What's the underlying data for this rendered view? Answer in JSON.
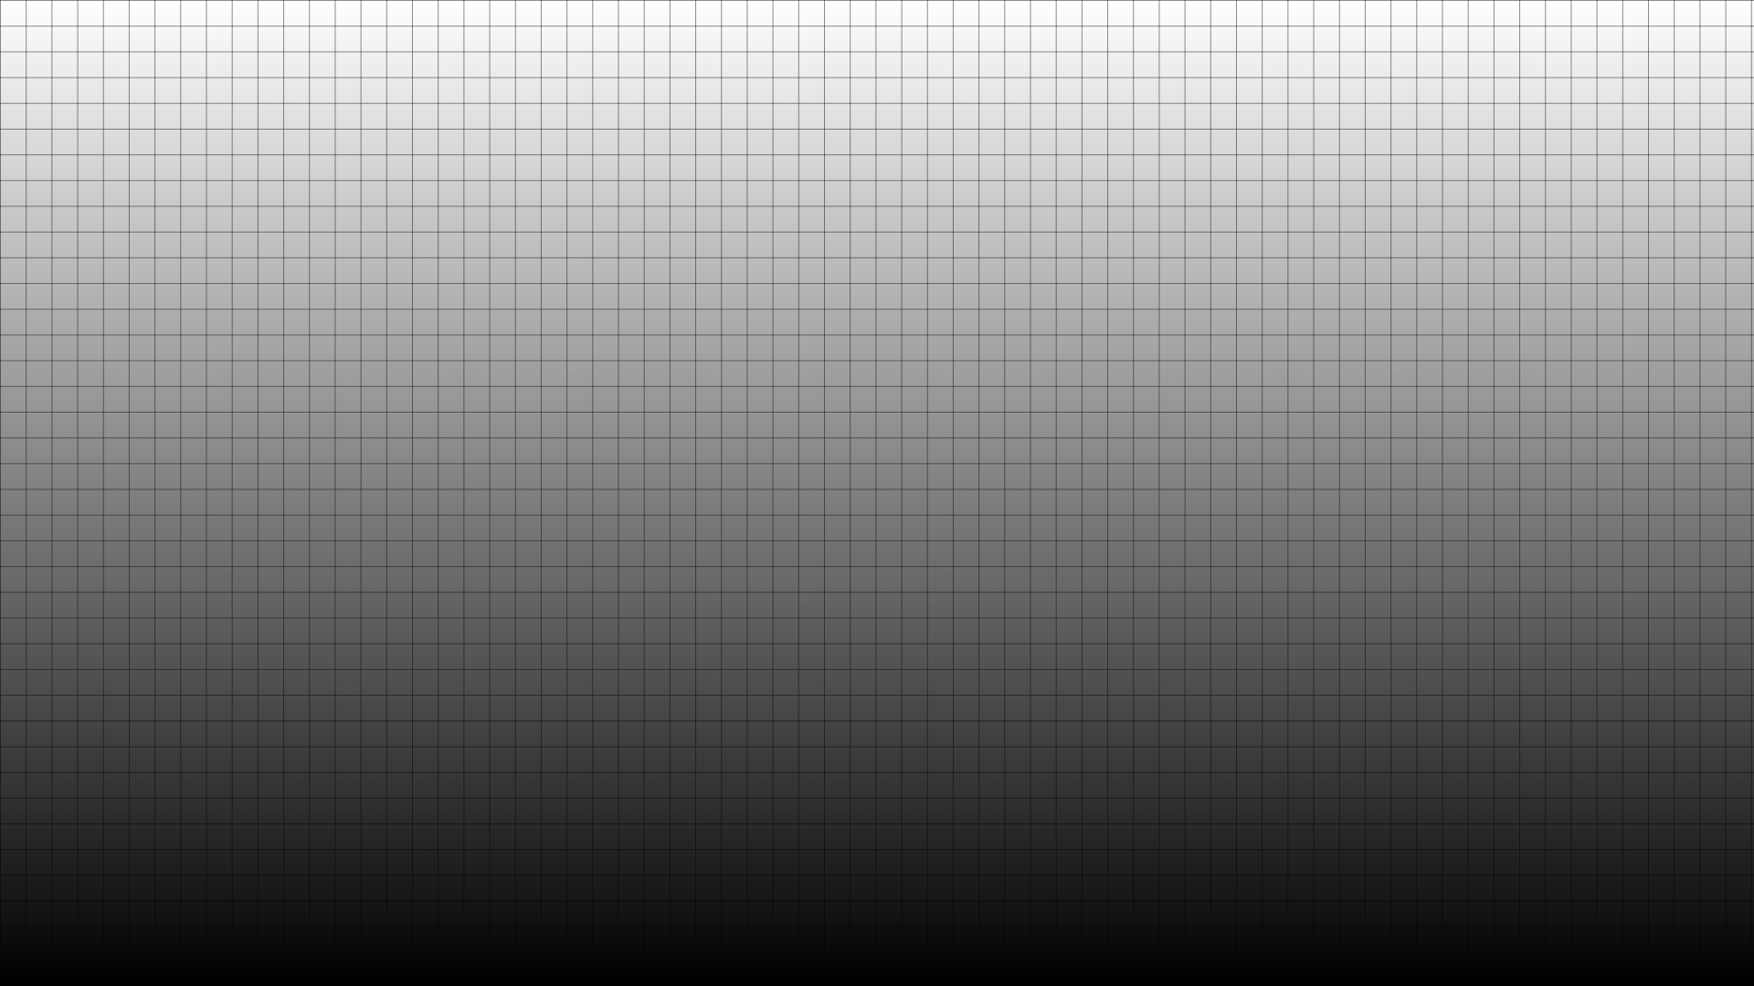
{
  "background": {
    "type": "vertical-gradient",
    "top_color": "#ffffff",
    "bottom_color": "#000000"
  },
  "grid": {
    "visible": true,
    "line_color": "#000000"
  }
}
